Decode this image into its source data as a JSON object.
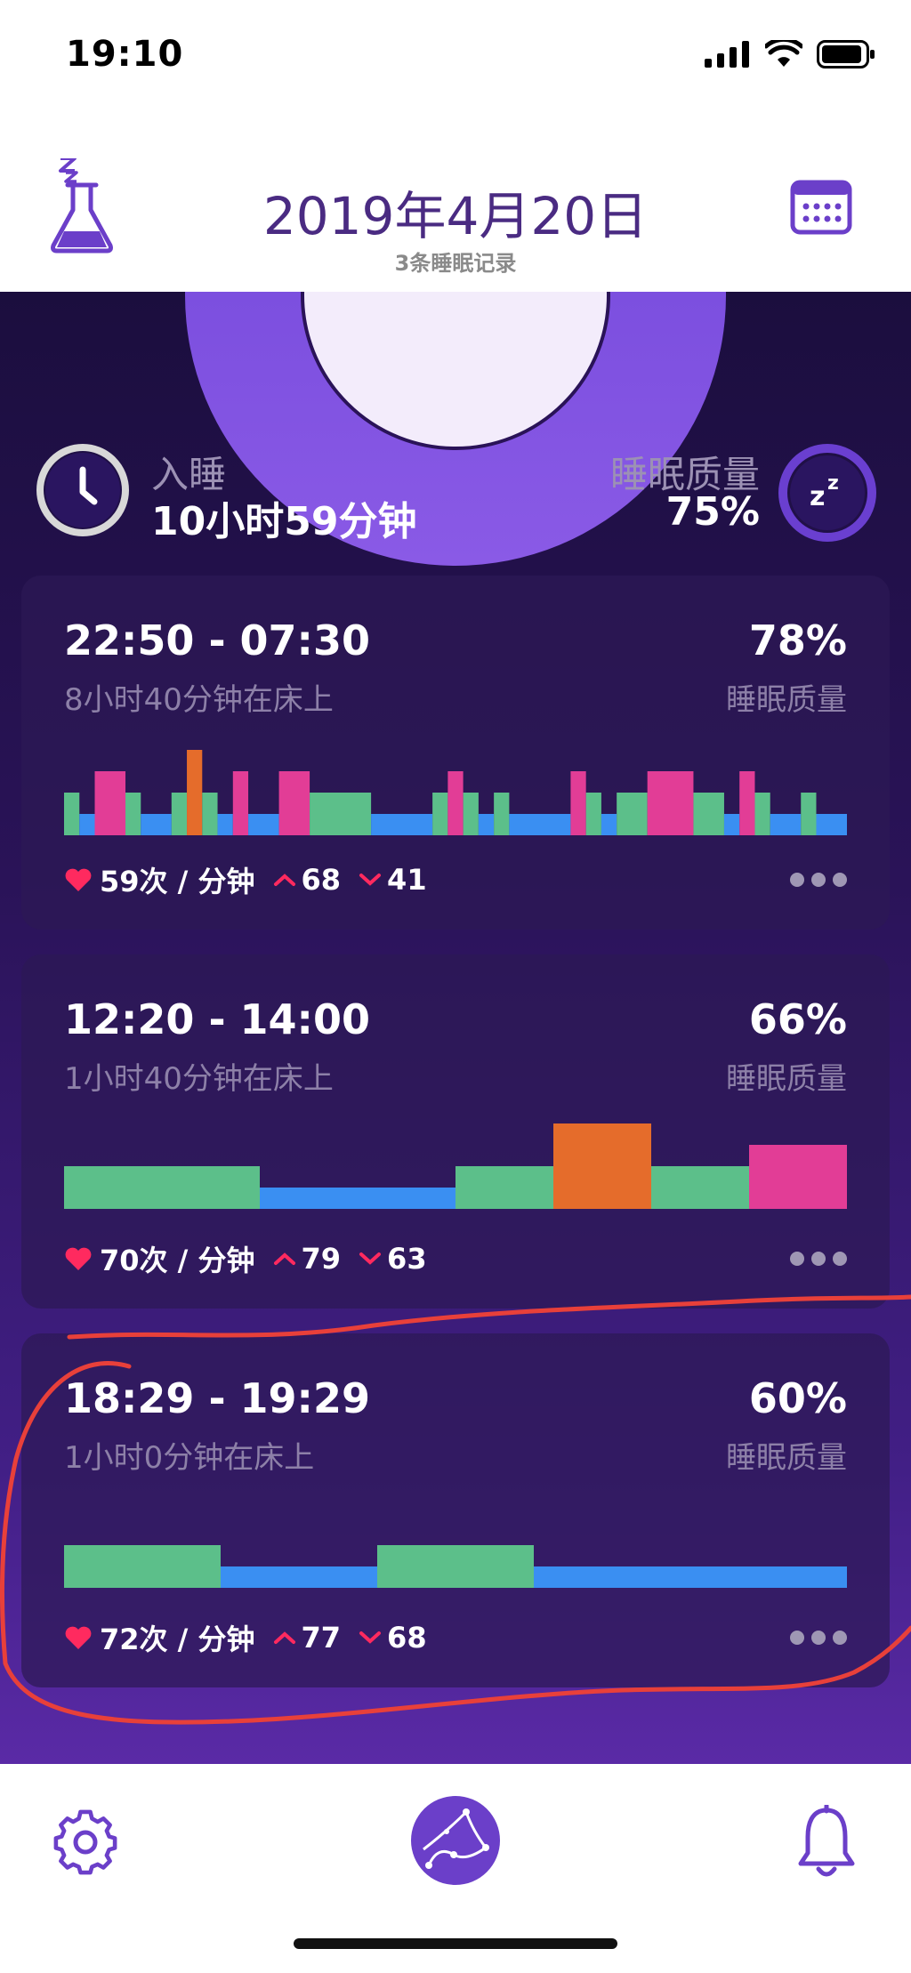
{
  "status_bar": {
    "time": "19:10"
  },
  "header": {
    "date": "2019年4月20日",
    "records_count": "3条睡眠记录",
    "icons": [
      "flask-sleep-icon",
      "calendar-icon"
    ]
  },
  "summary": {
    "asleep_label": "入睡",
    "asleep_value": "10小时59分钟",
    "quality_label": "睡眠质量",
    "quality_value": "75%"
  },
  "colors": {
    "deep": "#3a8ff2",
    "light": "#5cbf8a",
    "rem": "#e23d96",
    "awake": "#e56c2b",
    "accent": "#6b3fc9"
  },
  "sessions": [
    {
      "range": "22:50 - 07:30",
      "quality": "78%",
      "quality_label": "睡眠质量",
      "in_bed": "8小时40分钟在床上",
      "heart_rate": "59次 / 分钟",
      "hr_max": "68",
      "hr_min": "41",
      "stages": [
        "light",
        "deep",
        "rem",
        "light",
        "deep",
        "light",
        "awake",
        "light",
        "deep",
        "rem",
        "deep",
        "rem",
        "light",
        "deep",
        "light",
        "rem",
        "light",
        "deep",
        "light",
        "deep",
        "rem",
        "light",
        "deep",
        "light",
        "rem",
        "light",
        "deep",
        "rem",
        "light",
        "deep",
        "light",
        "deep"
      ]
    },
    {
      "range": "12:20 - 14:00",
      "quality": "66%",
      "quality_label": "睡眠质量",
      "in_bed": "1小时40分钟在床上",
      "heart_rate": "70次 / 分钟",
      "hr_max": "79",
      "hr_min": "63",
      "stages": [
        "light",
        "deep",
        "deep",
        "deep",
        "deep",
        "light",
        "awake",
        "light",
        "rem"
      ]
    },
    {
      "range": "18:29 - 19:29",
      "quality": "60%",
      "quality_label": "睡眠质量",
      "in_bed": "1小时0分钟在床上",
      "heart_rate": "72次 / 分钟",
      "hr_max": "77",
      "hr_min": "68",
      "stages": [
        "light",
        "deep",
        "deep",
        "light",
        "deep",
        "deep"
      ]
    }
  ],
  "tab_bar": {
    "icons": [
      "settings-gear-icon",
      "sleep-sounds-icon",
      "alarm-bell-icon"
    ]
  }
}
